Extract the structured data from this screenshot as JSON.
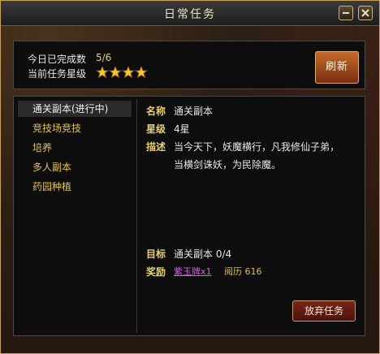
{
  "window": {
    "title": "日常任务"
  },
  "summary": {
    "completed_label": "今日已完成数",
    "completed_value": "5/6",
    "stars_label": "当前任务星级",
    "stars": 4
  },
  "refresh_label": "刷新",
  "task_list": [
    {
      "label": "通关副本(进行中)",
      "selected": true
    },
    {
      "label": "竞技场竞技",
      "selected": false
    },
    {
      "label": "培养",
      "selected": false
    },
    {
      "label": "多人副本",
      "selected": false
    },
    {
      "label": "药园种植",
      "selected": false
    }
  ],
  "details": {
    "name_label": "名称",
    "name": "通关副本",
    "star_label": "星级",
    "star": "4星",
    "desc_label": "描述",
    "desc_line1": "当今天下，妖魔横行，凡我修仙子弟，",
    "desc_line2": "当横剑诛妖，为民除魔。",
    "target_label": "目标",
    "target": "通关副本 0/4",
    "reward_label": "奖励",
    "reward_item": "紫玉牌x1",
    "reward_exp": "阅历 616"
  },
  "abandon_label": "放弃任务",
  "colors": {
    "frame": "#c9a15a",
    "accent_text": "#e4c44a",
    "reward_item": "#d060e0"
  }
}
